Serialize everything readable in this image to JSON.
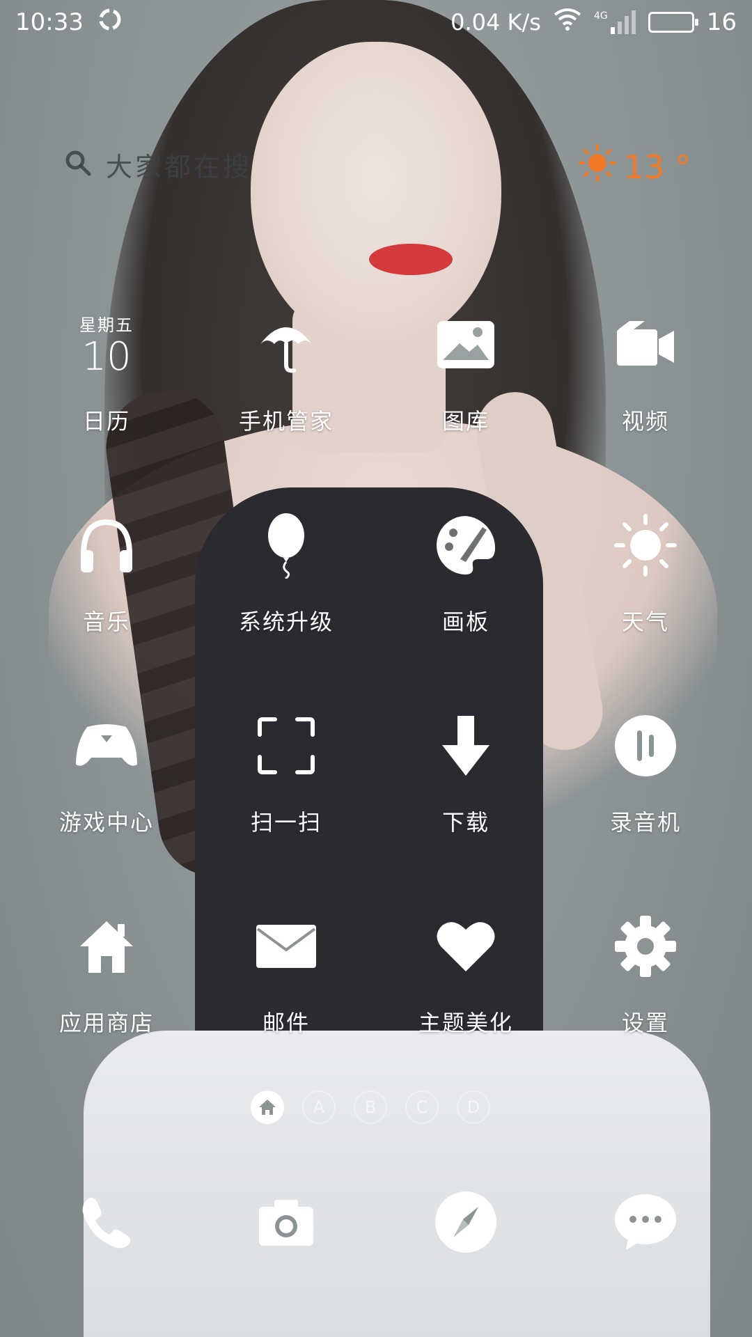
{
  "status_bar": {
    "time": "10:33",
    "speed": "0.04 K/s",
    "network": "4G",
    "battery": "16"
  },
  "search": {
    "placeholder": "大家都在搜"
  },
  "weather": {
    "temperature": "13 °",
    "icon": "sun-icon",
    "color": "#f07a28"
  },
  "calendar": {
    "weekday": "星期五",
    "day": "10"
  },
  "apps": [
    {
      "label": "日历",
      "icon": "calendar-icon"
    },
    {
      "label": "手机管家",
      "icon": "umbrella-icon"
    },
    {
      "label": "图库",
      "icon": "image-icon"
    },
    {
      "label": "视频",
      "icon": "video-camera-icon"
    },
    {
      "label": "音乐",
      "icon": "headphones-icon"
    },
    {
      "label": "系统升级",
      "icon": "balloon-icon"
    },
    {
      "label": "画板",
      "icon": "palette-icon"
    },
    {
      "label": "天气",
      "icon": "sun-icon"
    },
    {
      "label": "游戏中心",
      "icon": "gamepad-icon"
    },
    {
      "label": "扫一扫",
      "icon": "scan-frame-icon"
    },
    {
      "label": "下载",
      "icon": "download-arrow-icon"
    },
    {
      "label": "录音机",
      "icon": "recorder-icon"
    },
    {
      "label": "应用商店",
      "icon": "home-store-icon"
    },
    {
      "label": "邮件",
      "icon": "envelope-icon"
    },
    {
      "label": "主题美化",
      "icon": "heart-icon"
    },
    {
      "label": "设置",
      "icon": "gear-icon"
    }
  ],
  "pager": {
    "pages": [
      "A",
      "B",
      "C",
      "D"
    ],
    "active": "home"
  },
  "dock": [
    {
      "icon": "phone-icon"
    },
    {
      "icon": "camera-icon"
    },
    {
      "icon": "compass-icon"
    },
    {
      "icon": "message-bubble-icon"
    }
  ]
}
